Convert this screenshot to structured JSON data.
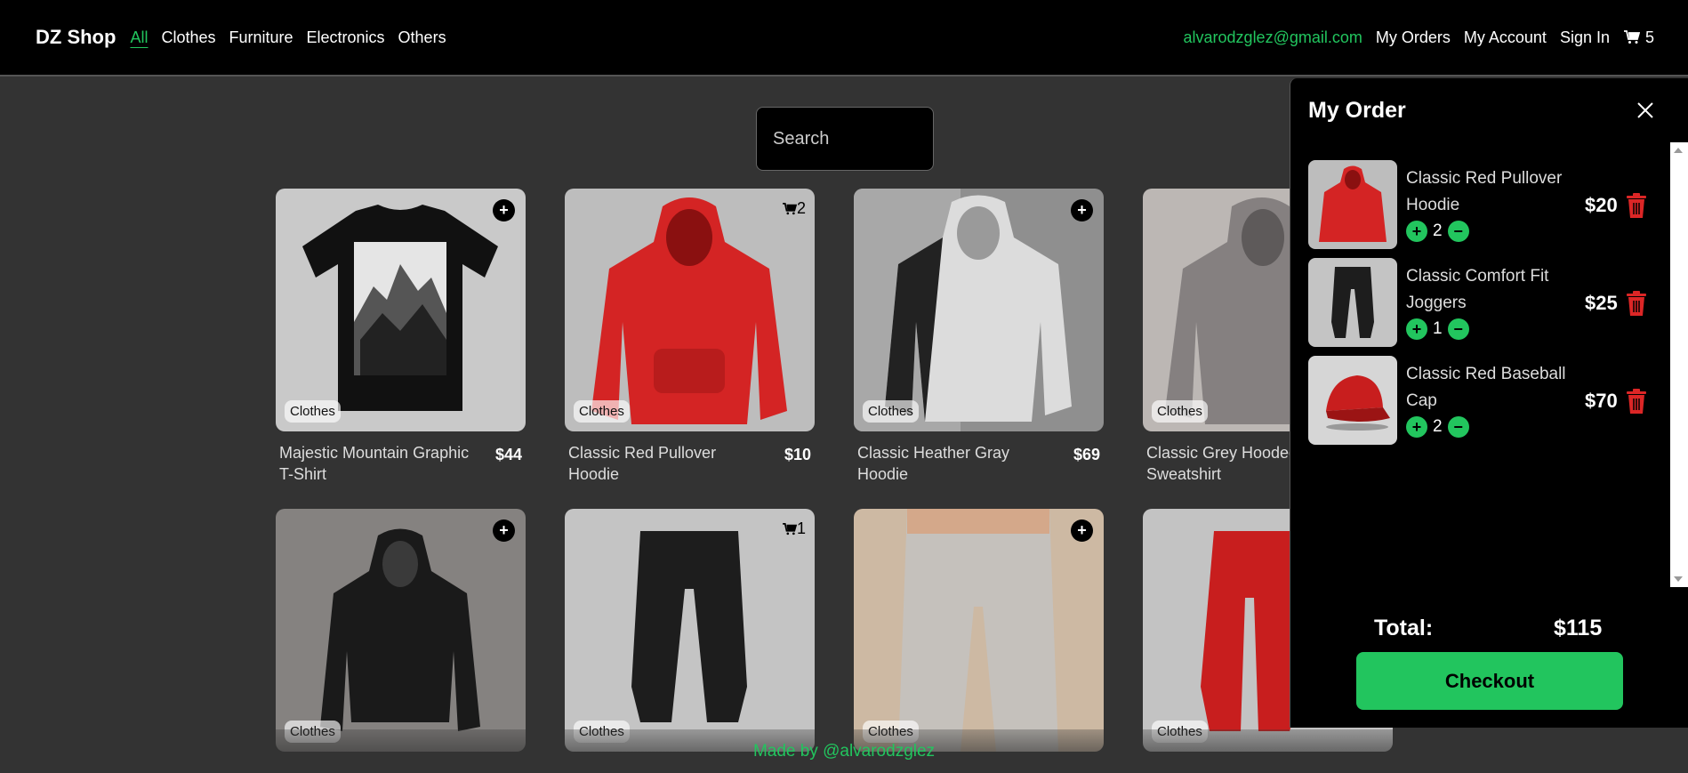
{
  "nav": {
    "brand": "DZ Shop",
    "categories": [
      "All",
      "Clothes",
      "Furniture",
      "Electronics",
      "Others"
    ],
    "email": "alvarodzglez@gmail.com",
    "links": [
      "My Orders",
      "My Account",
      "Sign In"
    ],
    "cart_count": "5"
  },
  "search": {
    "placeholder": "Search"
  },
  "products": [
    {
      "title": "Majestic Mountain Graphic T-Shirt",
      "price": "$44",
      "category": "Clothes",
      "in_cart": null
    },
    {
      "title": "Classic Red Pullover Hoodie",
      "price": "$10",
      "category": "Clothes",
      "in_cart": "2"
    },
    {
      "title": "Classic Heather Gray Hoodie",
      "price": "$69",
      "category": "Clothes",
      "in_cart": null
    },
    {
      "title": "Classic Grey Hooded Sweatshirt",
      "price": "",
      "category": "Clothes",
      "in_cart": null
    },
    {
      "title": "",
      "price": "",
      "category": "Clothes",
      "in_cart": null
    },
    {
      "title": "",
      "price": "",
      "category": "Clothes",
      "in_cart": "1"
    },
    {
      "title": "",
      "price": "",
      "category": "Clothes",
      "in_cart": null
    },
    {
      "title": "",
      "price": "",
      "category": "Clothes",
      "in_cart": null
    }
  ],
  "order": {
    "title": "My Order",
    "items": [
      {
        "name": "Classic Red Pullover Hoodie",
        "qty": "2",
        "price": "$20"
      },
      {
        "name": "Classic Comfort Fit Joggers",
        "qty": "1",
        "price": "$25"
      },
      {
        "name": "Classic Red Baseball Cap",
        "qty": "2",
        "price": "$70"
      }
    ],
    "total_label": "Total:",
    "total_value": "$115",
    "checkout_label": "Checkout"
  },
  "footer": {
    "text": "Made by @alvarodzglez"
  },
  "colors": {
    "accent": "#22c55e",
    "danger": "#dc2626",
    "background": "#333333",
    "nav": "#000000"
  }
}
